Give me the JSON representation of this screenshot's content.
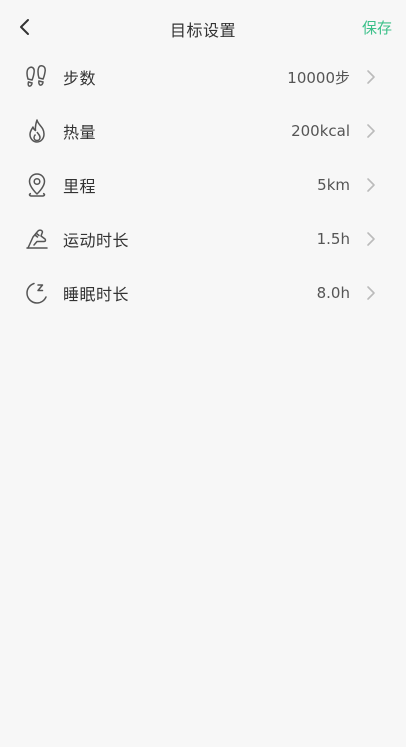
{
  "header": {
    "title": "目标设置",
    "save_label": "保存",
    "back_icon": "chevron-left-icon"
  },
  "colors": {
    "accent": "#3cc08a",
    "background": "#f7f7f7",
    "text": "#333333",
    "value_text": "#555555",
    "icon_stroke": "#555555",
    "chevron": "#bbbbbb"
  },
  "goals": [
    {
      "label": "步数",
      "value": "10000步",
      "icon": "footprints-icon"
    },
    {
      "label": "热量",
      "value": "200kcal",
      "icon": "flame-icon"
    },
    {
      "label": "里程",
      "value": "5km",
      "icon": "location-pin-icon"
    },
    {
      "label": "运动时长",
      "value": "1.5h",
      "icon": "running-shoe-icon"
    },
    {
      "label": "睡眠时长",
      "value": "8.0h",
      "icon": "sleep-moon-icon"
    }
  ]
}
